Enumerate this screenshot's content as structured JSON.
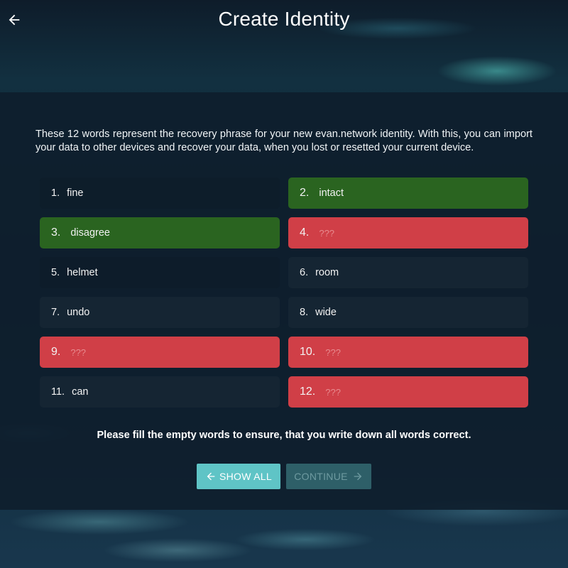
{
  "header": {
    "title": "Create Identity",
    "back_icon": "arrow-left-icon"
  },
  "intro_text": "These 12 words represent the recovery phrase for your new evan.network identity. With this, you can import your data to other devices and recover your data, when you lost or resetted your current device.",
  "words": [
    {
      "num": "1.",
      "word": "fine",
      "state": "plain"
    },
    {
      "num": "2.",
      "word": "intact",
      "state": "green"
    },
    {
      "num": "3.",
      "word": "disagree",
      "state": "green"
    },
    {
      "num": "4.",
      "word": "???",
      "state": "red"
    },
    {
      "num": "5.",
      "word": "helmet",
      "state": "plain"
    },
    {
      "num": "6.",
      "word": "room",
      "state": "dark"
    },
    {
      "num": "7.",
      "word": "undo",
      "state": "dark"
    },
    {
      "num": "8.",
      "word": "wide",
      "state": "dark"
    },
    {
      "num": "9.",
      "word": "???",
      "state": "red"
    },
    {
      "num": "10.",
      "word": "???",
      "state": "red"
    },
    {
      "num": "11.",
      "word": "can",
      "state": "dark"
    },
    {
      "num": "12.",
      "word": "???",
      "state": "red"
    }
  ],
  "note": "Please fill the empty words to ensure, that you write down all words correct.",
  "buttons": {
    "show_all": "SHOW ALL",
    "continue": "CONTINUE"
  },
  "colors": {
    "correct": "#2a6420",
    "missing": "#d03f47",
    "primary": "#5fc4c6",
    "disabled": "#2e5f68"
  }
}
